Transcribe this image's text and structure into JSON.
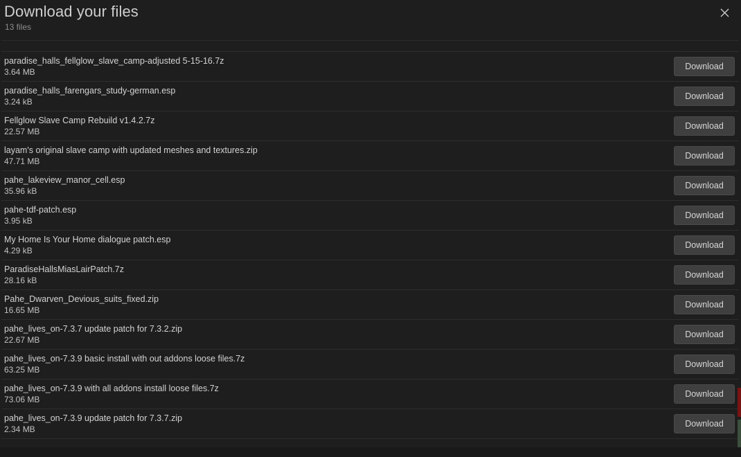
{
  "dialog": {
    "title": "Download your files",
    "file_count_label": "13 files",
    "close_icon": "close-icon"
  },
  "colors": {
    "background": "#1e1e1e",
    "divider": "#2e2e2e",
    "button_bg": "#3f3f3f",
    "text_primary": "#d3d3d3",
    "text_secondary": "#8d8d8d",
    "edge_red": "#7a1414",
    "edge_green": "#3d4f3d"
  },
  "download_button_label": "Download",
  "files": [
    {
      "name": "paradise_halls_fellglow_slave_camp-adjusted 5-15-16.7z",
      "size": "3.64 MB",
      "action": "Download"
    },
    {
      "name": "paradise_halls_farengars_study-german.esp",
      "size": "3.24 kB",
      "action": "Download"
    },
    {
      "name": "Fellglow Slave Camp Rebuild v1.4.2.7z",
      "size": "22.57 MB",
      "action": "Download"
    },
    {
      "name": "layam's original slave camp with updated meshes and textures.zip",
      "size": "47.71 MB",
      "action": "Download"
    },
    {
      "name": "pahe_lakeview_manor_cell.esp",
      "size": "35.96 kB",
      "action": "Download"
    },
    {
      "name": "pahe-tdf-patch.esp",
      "size": "3.95 kB",
      "action": "Download"
    },
    {
      "name": "My Home Is Your Home dialogue patch.esp",
      "size": "4.29 kB",
      "action": "Download"
    },
    {
      "name": "ParadiseHallsMiasLairPatch.7z",
      "size": "28.16 kB",
      "action": "Download"
    },
    {
      "name": "Pahe_Dwarven_Devious_suits_fixed.zip",
      "size": "16.65 MB",
      "action": "Download"
    },
    {
      "name": "pahe_lives_on-7.3.7 update patch for 7.3.2.zip",
      "size": "22.67 MB",
      "action": "Download"
    },
    {
      "name": "pahe_lives_on-7.3.9 basic install with out addons loose files.7z",
      "size": "63.25 MB",
      "action": "Download"
    },
    {
      "name": "pahe_lives_on-7.3.9 with all addons install loose files.7z",
      "size": "73.06 MB",
      "action": "Download"
    },
    {
      "name": "pahe_lives_on-7.3.9 update patch for 7.3.7.zip",
      "size": "2.34 MB",
      "action": "Download"
    }
  ]
}
